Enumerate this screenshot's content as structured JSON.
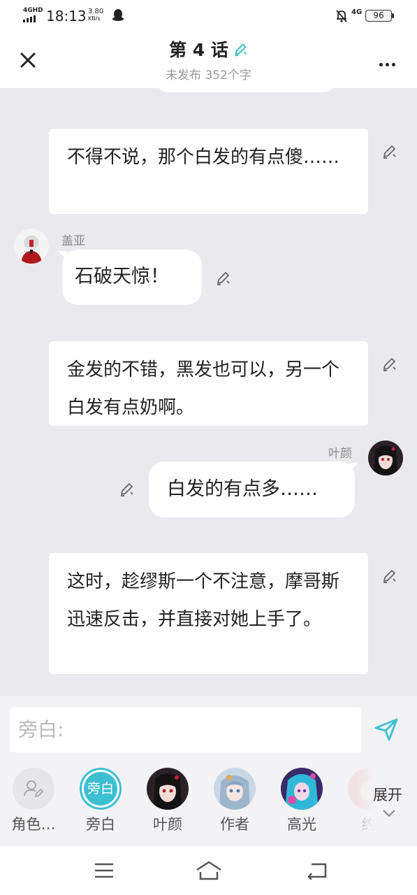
{
  "status_bar": {
    "network": "4GHD",
    "time": "18:13",
    "speed_value": "3.80",
    "speed_unit": "KB/s",
    "signal_right": "4G",
    "battery": "96"
  },
  "header": {
    "title": "第 4 话",
    "status": "未发布",
    "word_count": "352个字"
  },
  "messages": [
    {
      "type": "narration",
      "text": "不得不说，那个白发的有点傻……"
    },
    {
      "type": "left",
      "name": "盖亚",
      "text": "石破天惊！"
    },
    {
      "type": "narration",
      "text": "金发的不错，黑发也可以，另一个白发有点奶啊。"
    },
    {
      "type": "right",
      "name": "叶颜",
      "text": "白发的有点多……"
    },
    {
      "type": "narration",
      "text": "这时，趁缪斯一个不注意，摩哥斯迅速反击，并直接对她上手了。"
    }
  ],
  "input": {
    "placeholder": "旁白:"
  },
  "roles": [
    {
      "label": "角色…"
    },
    {
      "label": "旁白",
      "avatar_text": "旁白"
    },
    {
      "label": "叶颜"
    },
    {
      "label": "作者"
    },
    {
      "label": "高光"
    },
    {
      "label": "约"
    }
  ],
  "expand_label": "展开",
  "colors": {
    "accent": "#3cbfd0",
    "background": "#e9e9ee"
  }
}
